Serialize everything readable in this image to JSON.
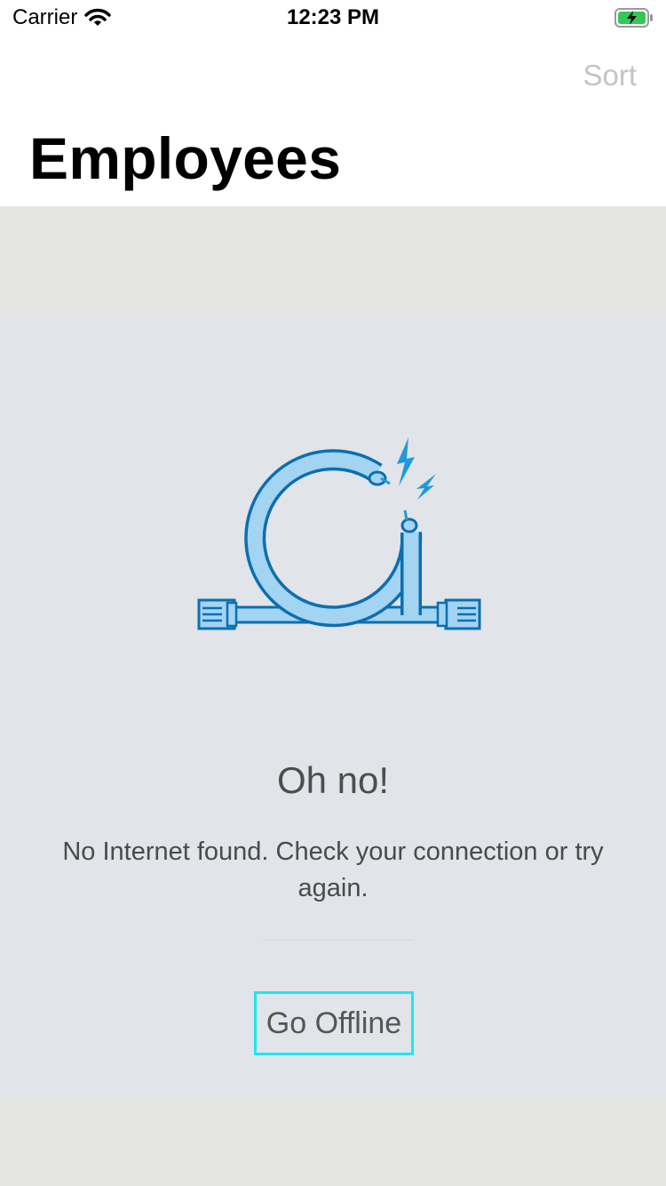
{
  "status_bar": {
    "carrier": "Carrier",
    "time": "12:23 PM",
    "wifi_icon": "wifi-icon",
    "battery_icon": "battery-charging-icon"
  },
  "nav": {
    "sort_label": "Sort",
    "title": "Employees"
  },
  "error_state": {
    "illustration_icon": "broken-cable-icon",
    "title": "Oh no!",
    "message": "No Internet found. Check your connection or try again.",
    "action_label": "Go Offline"
  },
  "colors": {
    "cable_fill": "#a3d4f2",
    "cable_stroke": "#0b6fb0",
    "spark": "#1f9ad8",
    "focus_outline": "#1ee6f0"
  }
}
